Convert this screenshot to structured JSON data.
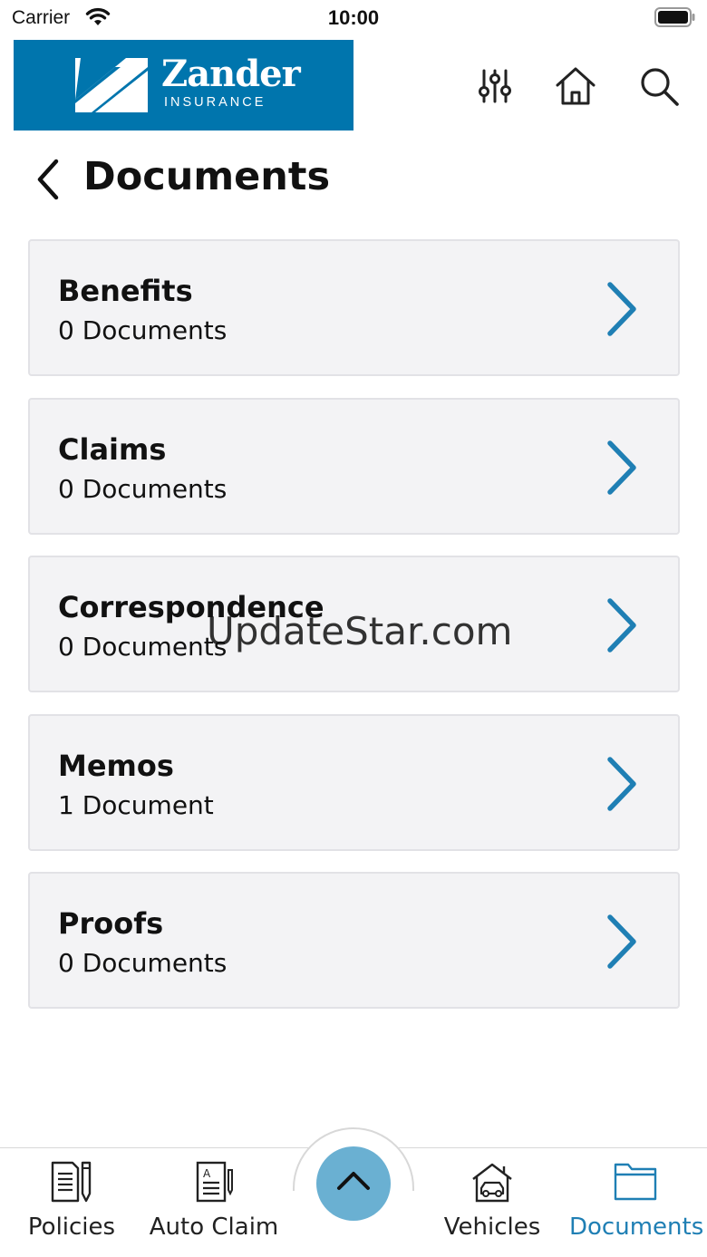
{
  "status_bar": {
    "carrier": "Carrier",
    "time": "10:00"
  },
  "header": {
    "brand": {
      "name": "Zander",
      "tagline": "INSURANCE",
      "color": "#0075ad"
    },
    "icons": [
      "sliders-icon",
      "home-icon",
      "search-icon"
    ]
  },
  "page": {
    "title": "Documents"
  },
  "categories": [
    {
      "name": "Benefits",
      "count": "0 Documents"
    },
    {
      "name": "Claims",
      "count": "0 Documents"
    },
    {
      "name": "Correspondence",
      "count": "0 Documents"
    },
    {
      "name": "Memos",
      "count": "1 Document"
    },
    {
      "name": "Proofs",
      "count": "0 Documents"
    }
  ],
  "watermark": "UpdateStar.com",
  "tabbar": {
    "tabs": [
      {
        "label": "Policies",
        "icon": "policy-document-icon"
      },
      {
        "label": "Auto Claim",
        "icon": "claim-form-icon"
      },
      {
        "label": "Vehicles",
        "icon": "vehicle-garage-icon"
      },
      {
        "label": "Documents",
        "icon": "folder-icon",
        "active": true
      }
    ],
    "fab_icon": "chevron-up-icon",
    "active_color": "#1f7fb4",
    "fab_color": "#6ab0d2"
  }
}
